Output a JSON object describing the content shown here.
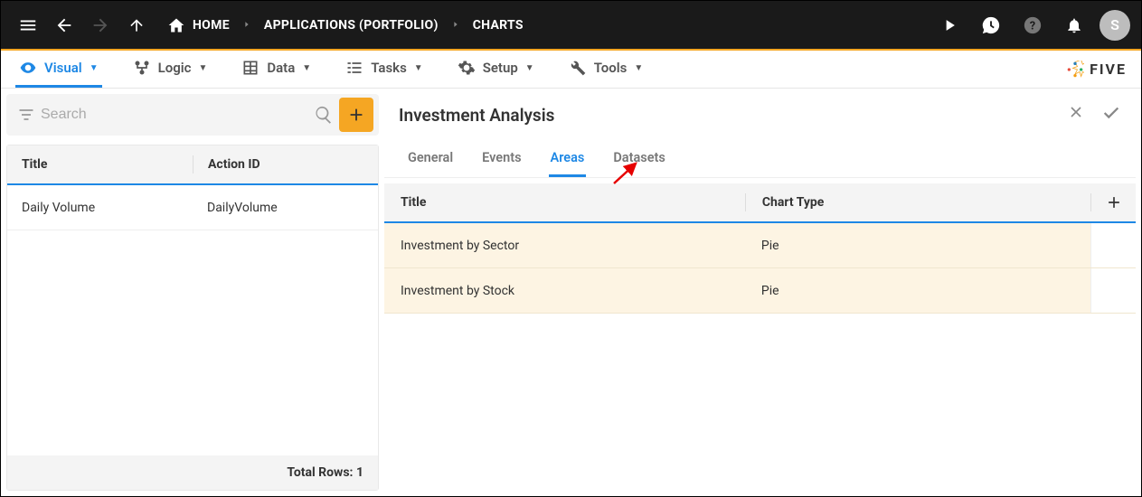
{
  "topbar": {
    "breadcrumbs": [
      {
        "label": "HOME",
        "hasHomeIcon": true
      },
      {
        "label": "APPLICATIONS (PORTFOLIO)"
      },
      {
        "label": "CHARTS"
      }
    ],
    "avatar_initial": "S"
  },
  "subnav": {
    "items": [
      {
        "label": "Visual",
        "active": true
      },
      {
        "label": "Logic"
      },
      {
        "label": "Data"
      },
      {
        "label": "Tasks"
      },
      {
        "label": "Setup"
      },
      {
        "label": "Tools"
      }
    ],
    "brand": "FIVE"
  },
  "left": {
    "search_placeholder": "Search",
    "columns": [
      "Title",
      "Action ID"
    ],
    "rows": [
      {
        "title": "Daily Volume",
        "action_id": "DailyVolume"
      }
    ],
    "footer_label": "Total Rows:",
    "footer_count": "1"
  },
  "detail": {
    "title": "Investment Analysis",
    "tabs": [
      {
        "label": "General"
      },
      {
        "label": "Events"
      },
      {
        "label": "Areas",
        "active": true
      },
      {
        "label": "Datasets"
      }
    ],
    "columns": [
      "Title",
      "Chart Type"
    ],
    "rows": [
      {
        "title": "Investment by Sector",
        "chart_type": "Pie"
      },
      {
        "title": "Investment by Stock",
        "chart_type": "Pie"
      }
    ]
  }
}
